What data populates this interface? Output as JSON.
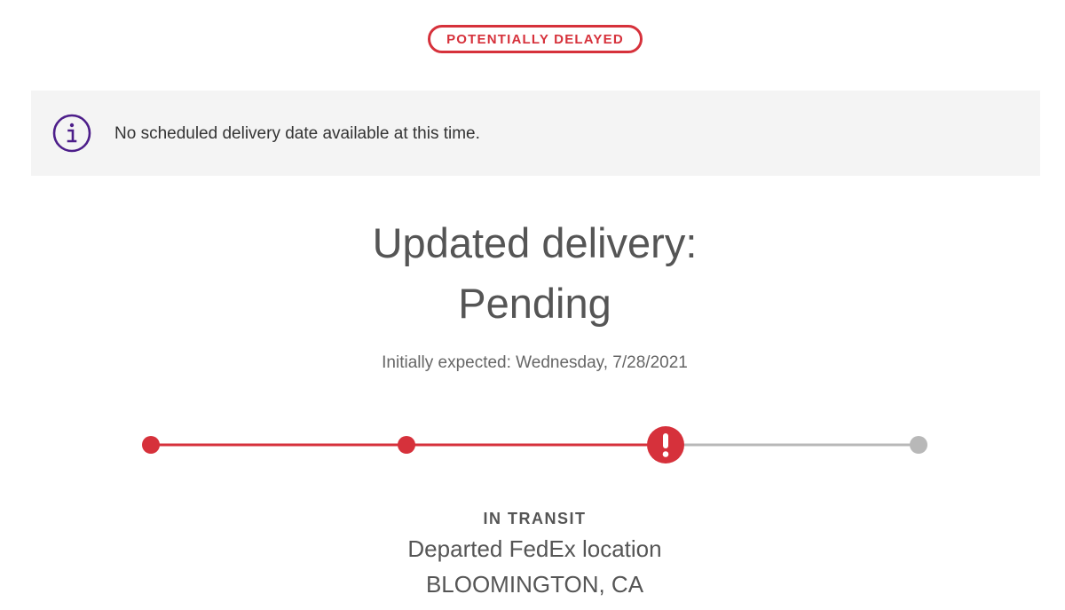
{
  "status_badge": {
    "label": "POTENTIALLY DELAYED",
    "color": "#d6313b"
  },
  "banner": {
    "icon": "info-icon",
    "icon_color": "#4d1e8a",
    "message": "No scheduled delivery date available at this time."
  },
  "delivery": {
    "heading_line1": "Updated delivery:",
    "heading_line2": "Pending",
    "initially_expected": "Initially expected: Wednesday, 7/28/2021"
  },
  "progress": {
    "steps_total": 4,
    "steps_completed": 2,
    "current_step_state": "exception",
    "current_step_icon": "exclamation-icon",
    "active_color": "#d6313b",
    "inactive_color": "#b8b8b8"
  },
  "latest_status": {
    "label": "IN TRANSIT",
    "description": "Departed FedEx location",
    "location": "BLOOMINGTON, CA"
  }
}
